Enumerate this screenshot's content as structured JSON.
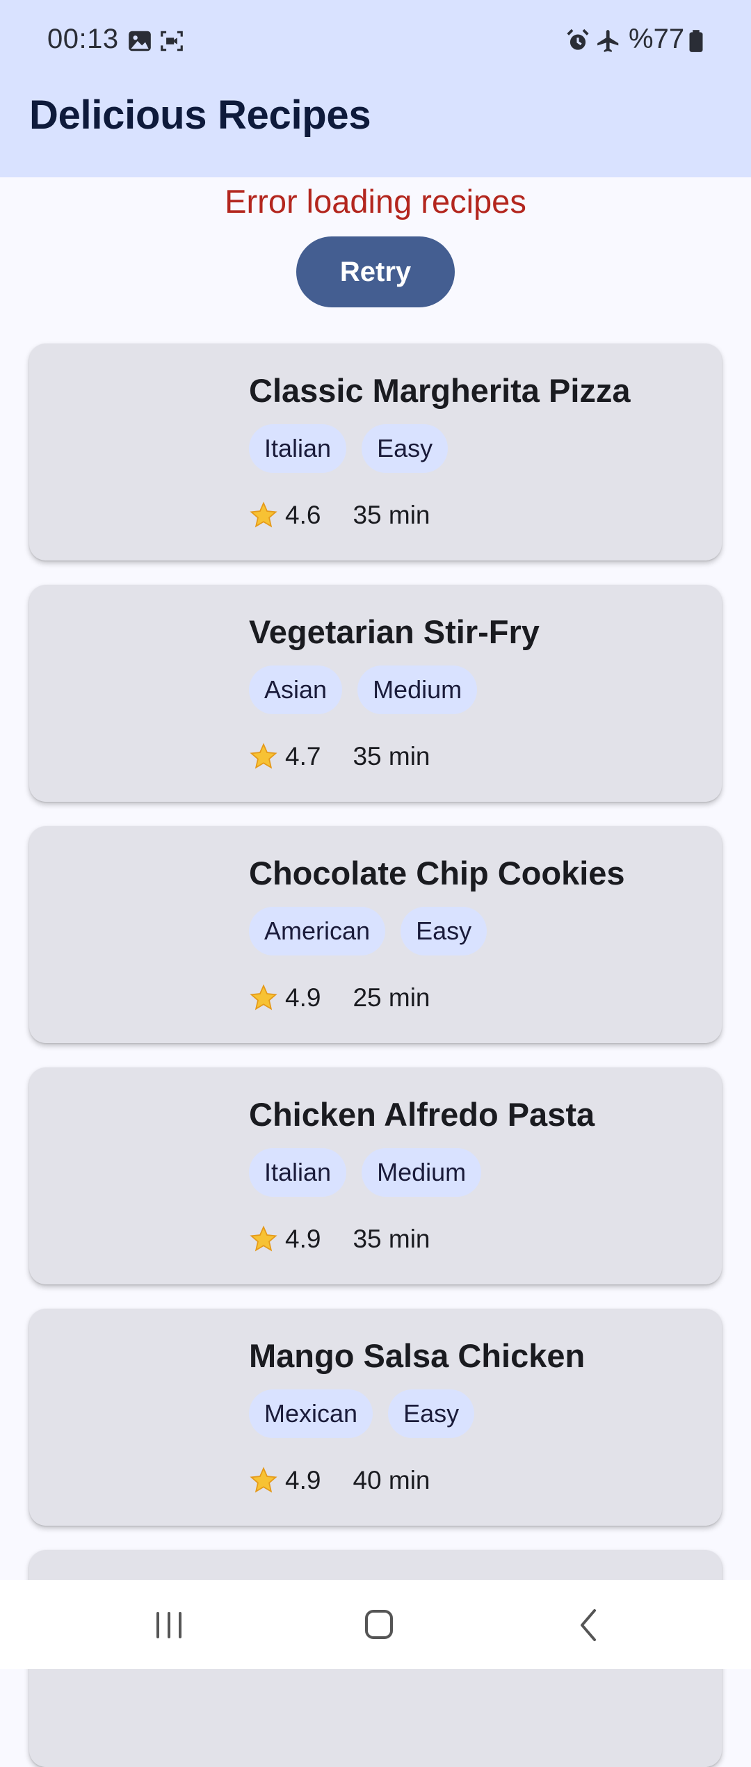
{
  "status_bar": {
    "time": "00:13",
    "battery": "%77",
    "icons": [
      "image-icon",
      "screen-record-icon",
      "alarm-icon",
      "airplane-mode-icon",
      "battery-icon"
    ]
  },
  "app_bar": {
    "title": "Delicious Recipes",
    "background": "#D9E2FF"
  },
  "error": {
    "message": "Error loading recipes",
    "color": "#B3261E"
  },
  "retry": {
    "label": "Retry",
    "color": "#445E91"
  },
  "recipes": [
    {
      "title": "Classic Margherita Pizza",
      "tags": [
        "Italian",
        "Easy"
      ],
      "rating": "4.6",
      "time": "35 min"
    },
    {
      "title": "Vegetarian Stir-Fry",
      "tags": [
        "Asian",
        "Medium"
      ],
      "rating": "4.7",
      "time": "35 min"
    },
    {
      "title": "Chocolate Chip Cookies",
      "tags": [
        "American",
        "Easy"
      ],
      "rating": "4.9",
      "time": "25 min"
    },
    {
      "title": "Chicken Alfredo Pasta",
      "tags": [
        "Italian",
        "Medium"
      ],
      "rating": "4.9",
      "time": "35 min"
    },
    {
      "title": "Mango Salsa Chicken",
      "tags": [
        "Mexican",
        "Easy"
      ],
      "rating": "4.9",
      "time": "40 min"
    }
  ],
  "nav_bar": {
    "buttons": [
      "recent-apps",
      "home",
      "back"
    ]
  }
}
